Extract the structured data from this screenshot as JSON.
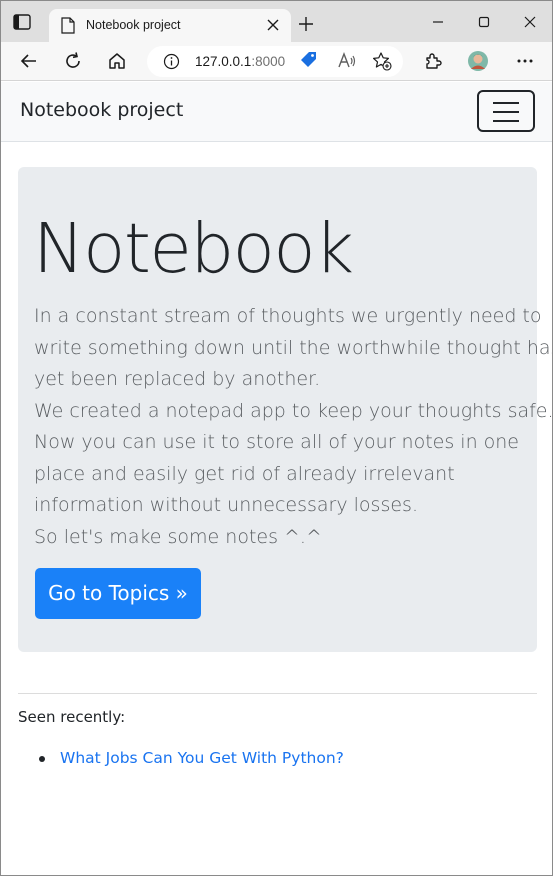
{
  "browser": {
    "tab_title": "Notebook project",
    "url_host": "127.0.0.1",
    "url_port": ":8000"
  },
  "navbar": {
    "brand": "Notebook project"
  },
  "jumbotron": {
    "heading": "Notebook",
    "lead_lines": [
      "In a constant stream of thoughts we urgently need to",
      "write something down until the worthwhile thought has",
      "yet been replaced by another.",
      "We created a notepad app to keep your thoughts safe.",
      "Now you can use it to store all of your notes in one",
      "place and easily get rid of already irrelevant",
      "information without unnecessary losses.",
      "So let's make some notes ^.^"
    ],
    "button_label": "Go to Topics »"
  },
  "recent": {
    "label": "Seen recently:",
    "items": [
      "What Jobs Can You Get With Python?"
    ]
  },
  "colors": {
    "accent": "#1a81f8",
    "link": "#1a74f0",
    "jumbotron_bg": "#e9ecef",
    "navbar_bg": "#f8f9fa"
  },
  "icons": {
    "tab_actions": "tab-actions-icon",
    "favicon": "page-icon",
    "tab_close": "close-icon",
    "new_tab": "plus-icon",
    "minimize": "minimize-icon",
    "maximize": "maximize-icon",
    "close_window": "close-window-icon",
    "back": "back-arrow-icon",
    "refresh": "refresh-icon",
    "home": "home-icon",
    "info": "info-icon",
    "tag": "tag-icon",
    "read_aloud": "read-aloud-icon",
    "favorite": "add-favorite-icon",
    "extensions": "extensions-icon",
    "profile": "profile-avatar-icon",
    "more": "more-icon",
    "menu": "hamburger-icon"
  }
}
